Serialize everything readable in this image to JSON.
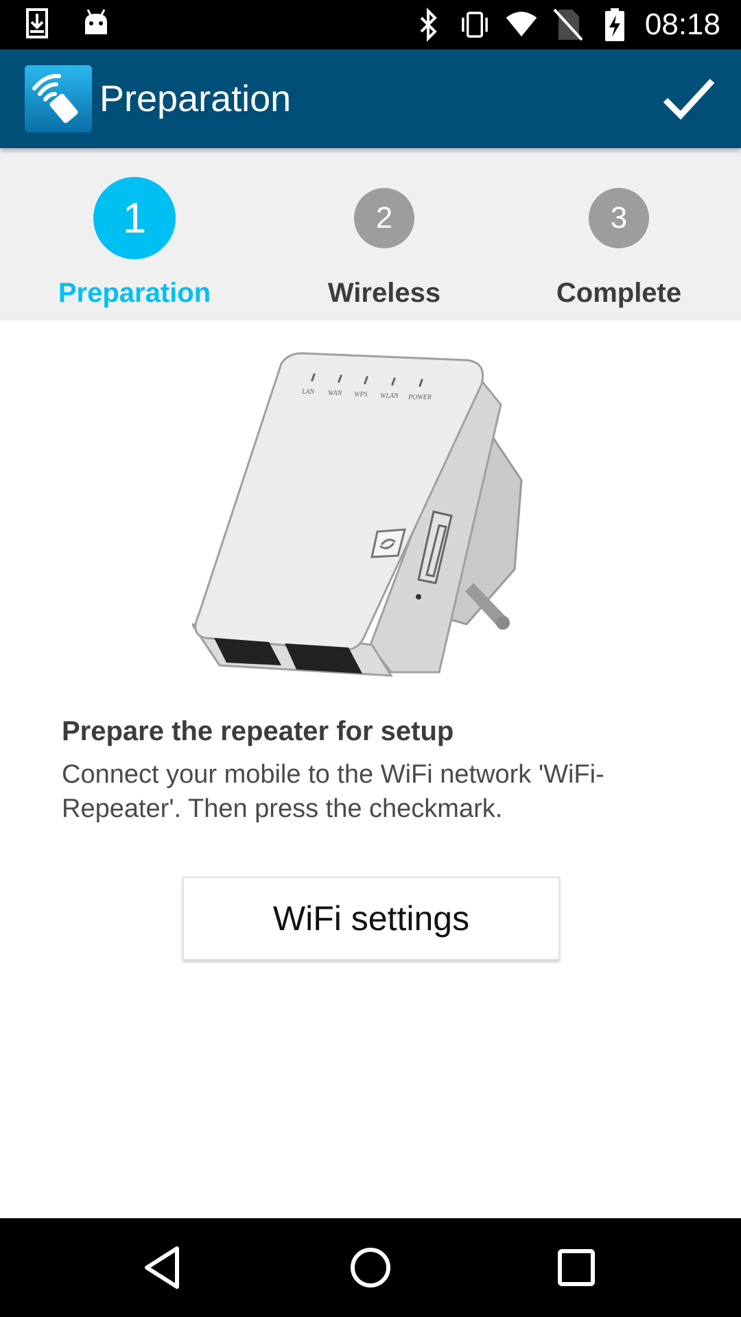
{
  "status_bar": {
    "time": "08:18",
    "left_icons": [
      "download-icon",
      "android-icon"
    ],
    "right_icons": [
      "bluetooth-icon",
      "vibrate-icon",
      "wifi-icon",
      "no-sim-icon",
      "battery-charging-icon"
    ]
  },
  "app_bar": {
    "title": "Preparation",
    "confirm_icon": "checkmark-icon",
    "background_color": "#004f78"
  },
  "steps": [
    {
      "number": "1",
      "label": "Preparation",
      "active": true
    },
    {
      "number": "2",
      "label": "Wireless",
      "active": false
    },
    {
      "number": "3",
      "label": "Complete",
      "active": false
    }
  ],
  "accent_color": "#00bff3",
  "device_leds": [
    "LAN",
    "WAN",
    "WPS",
    "WLAN",
    "POWER"
  ],
  "content": {
    "heading": "Prepare the repeater for setup",
    "description": "Connect your mobile to the WiFi network 'WiFi-Repeater'. Then press the checkmark.",
    "button_label": "WiFi settings"
  },
  "nav_bar": {
    "icons": [
      "back-icon",
      "home-icon",
      "recents-icon"
    ]
  }
}
